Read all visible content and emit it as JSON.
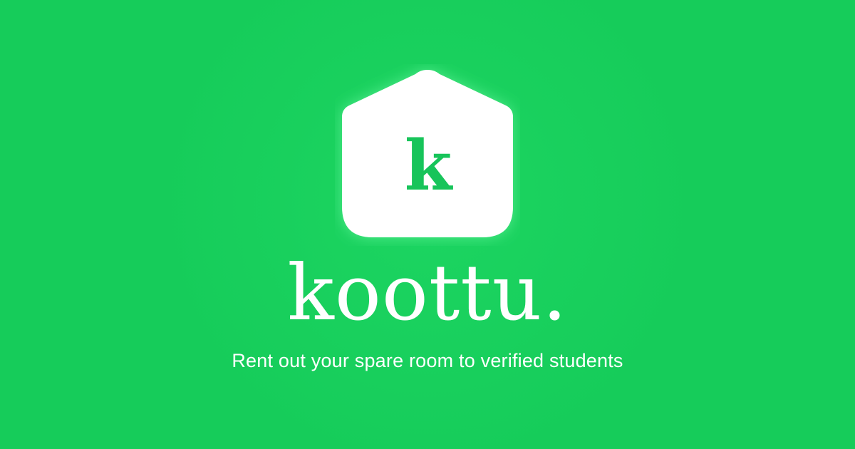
{
  "brand": {
    "logo_letter": "k",
    "name": "koottu.",
    "tagline": "Rent out your spare room to verified students"
  },
  "icons": {
    "logo": "house-icon"
  },
  "colors": {
    "background": "#16cc5a",
    "logo_fill": "#ffffff",
    "logo_letter": "#17c45a",
    "text": "#ffffff"
  }
}
